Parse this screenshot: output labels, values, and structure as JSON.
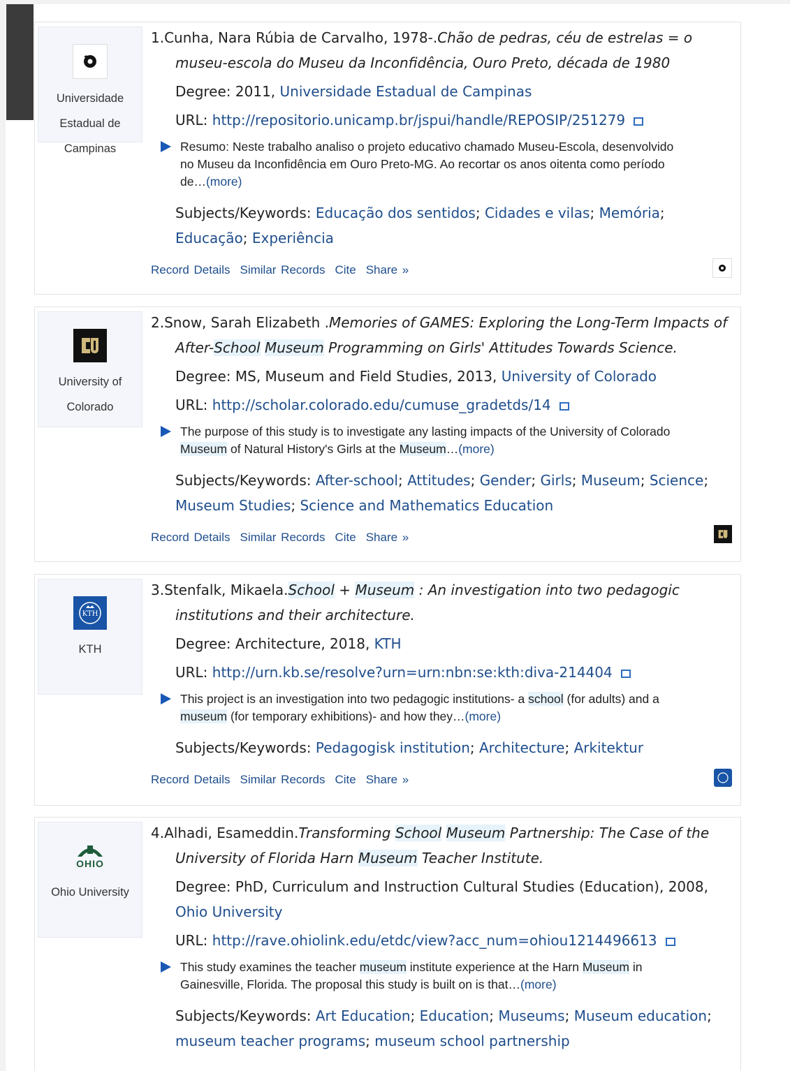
{
  "records": [
    {
      "num": "1.",
      "author": "Cunha, Nara Rúbia de Carvalho, 1978-.",
      "title_text": "Chão de pedras, céu de estrelas = o museu-escola do Museu da Inconfidência, Ouro Preto, década de 1980",
      "degree_prefix": "Degree: 2011, ",
      "institution": "Universidade Estadual de Campinas",
      "url_label": "URL: ",
      "url": "http://repositorio.unicamp.br/jspui/handle/REPOSIP/251279",
      "abstract": "Resumo: Neste trabalho analiso o projeto educativo chamado Museu-Escola, desenvolvido no Museu da Inconfidência em Ouro Preto-MG. Ao recortar os anos oitenta como período de…",
      "more": "(more)",
      "subjects_label": "Subjects/Keywords: ",
      "subjects": [
        "Educação dos sentidos",
        "Cidades e vilas",
        "Memória",
        "Educação",
        "Experiência"
      ],
      "logo_name": "Universidade Estadual de Campinas"
    },
    {
      "num": "2.",
      "author": "Snow, Sarah Elizabeth .",
      "title_pre": "Memories of GAMES: Exploring the Long-Term Impacts of After-",
      "title_hl1": "School",
      "title_mid": " ",
      "title_hl2": "Museum",
      "title_post": " Programming on Girls' Attitudes Towards Science.",
      "degree_prefix": "Degree: MS, Museum and Field Studies, 2013, ",
      "institution": "University of Colorado",
      "url_label": "URL: ",
      "url": "http://scholar.colorado.edu/cumuse_gradetds/14",
      "abs_pre": "The purpose of this study is to investigate any lasting impacts of the University of Colorado ",
      "abs_hl1": "Museum",
      "abs_mid": " of Natural History's Girls at the ",
      "abs_hl2": "Museum",
      "abs_post": "…",
      "more": "(more)",
      "subjects_label": "Subjects/Keywords: ",
      "subjects": [
        "After-school",
        "Attitudes",
        "Gender",
        "Girls",
        "Museum",
        "Science",
        "Museum Studies",
        "Science and Mathematics Education"
      ],
      "logo_name": "University of Colorado"
    },
    {
      "num": "3.",
      "author": "Stenfalk, Mikaela.",
      "title_hl1": "School",
      "title_mid": " + ",
      "title_hl2": "Museum",
      "title_post": " : An investigation into two pedagogic institutions and their architecture.",
      "degree_prefix": "Degree: Architecture, 2018, ",
      "institution": "KTH",
      "url_label": "URL: ",
      "url": "http://urn.kb.se/resolve?urn=urn:nbn:se:kth:diva-214404",
      "abs_pre": "This project is an investigation into two pedagogic institutions- a ",
      "abs_hl1": "school",
      "abs_mid": " (for adults) and a ",
      "abs_hl2": "museum",
      "abs_post": " (for temporary exhibitions)- and how they…",
      "more": "(more)",
      "subjects_label": "Subjects/Keywords: ",
      "subjects": [
        "Pedagogisk institution",
        "Architecture",
        "Arkitektur"
      ],
      "logo_name": "KTH"
    },
    {
      "num": "4.",
      "author": "Alhadi, Esameddin.",
      "title_pre": "Transforming ",
      "title_hl1": "School",
      "title_mid": " ",
      "title_hl2": "Museum",
      "title_mid2": " Partnership: The Case of the University of Florida Harn ",
      "title_hl3": "Museum",
      "title_post": " Teacher Institute.",
      "degree_prefix": "Degree: PhD, Curriculum and Instruction Cultural Studies (Education), 2008, ",
      "institution": "Ohio University",
      "url_label": "URL: ",
      "url": "http://rave.ohiolink.edu/etdc/view?acc_num=ohiou1214496613",
      "abs_pre": "This study examines the teacher ",
      "abs_hl1": "museum",
      "abs_mid": " institute experience at the Harn ",
      "abs_hl2": "Museum",
      "abs_post": " in Gainesville, Florida. The proposal this study is built on is that…",
      "more": "(more)",
      "subjects_label": "Subjects/Keywords: ",
      "subjects": [
        "Art Education",
        "Education",
        "Museums",
        "Museum education",
        "museum teacher programs",
        "museum school partnership"
      ],
      "logo_name": "Ohio University"
    }
  ],
  "actions": {
    "details": "Record Details",
    "similar": "Similar Records",
    "cite": "Cite",
    "share": "Share »"
  },
  "logo_texts": {
    "ohio": "OHIO",
    "kth": "KTH"
  },
  "colors": {
    "link": "#1f4e8c",
    "highlight": "#e6f3fb",
    "arrow": "#1a58b5",
    "colorado_gold": "#cfb87c",
    "kth_blue": "#1954a6",
    "ohio_green": "#1e5b3a"
  }
}
